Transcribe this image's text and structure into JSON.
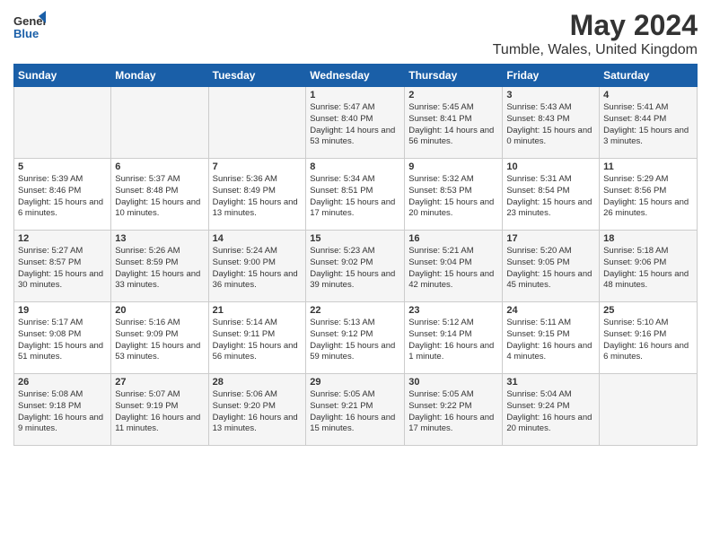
{
  "header": {
    "logo": {
      "general": "General",
      "blue": "Blue"
    },
    "title": "May 2024",
    "subtitle": "Tumble, Wales, United Kingdom"
  },
  "calendar": {
    "headers": [
      "Sunday",
      "Monday",
      "Tuesday",
      "Wednesday",
      "Thursday",
      "Friday",
      "Saturday"
    ],
    "weeks": [
      [
        {
          "day": "",
          "info": ""
        },
        {
          "day": "",
          "info": ""
        },
        {
          "day": "",
          "info": ""
        },
        {
          "day": "1",
          "info": "Sunrise: 5:47 AM\nSunset: 8:40 PM\nDaylight: 14 hours and 53 minutes."
        },
        {
          "day": "2",
          "info": "Sunrise: 5:45 AM\nSunset: 8:41 PM\nDaylight: 14 hours and 56 minutes."
        },
        {
          "day": "3",
          "info": "Sunrise: 5:43 AM\nSunset: 8:43 PM\nDaylight: 15 hours and 0 minutes."
        },
        {
          "day": "4",
          "info": "Sunrise: 5:41 AM\nSunset: 8:44 PM\nDaylight: 15 hours and 3 minutes."
        }
      ],
      [
        {
          "day": "5",
          "info": "Sunrise: 5:39 AM\nSunset: 8:46 PM\nDaylight: 15 hours and 6 minutes."
        },
        {
          "day": "6",
          "info": "Sunrise: 5:37 AM\nSunset: 8:48 PM\nDaylight: 15 hours and 10 minutes."
        },
        {
          "day": "7",
          "info": "Sunrise: 5:36 AM\nSunset: 8:49 PM\nDaylight: 15 hours and 13 minutes."
        },
        {
          "day": "8",
          "info": "Sunrise: 5:34 AM\nSunset: 8:51 PM\nDaylight: 15 hours and 17 minutes."
        },
        {
          "day": "9",
          "info": "Sunrise: 5:32 AM\nSunset: 8:53 PM\nDaylight: 15 hours and 20 minutes."
        },
        {
          "day": "10",
          "info": "Sunrise: 5:31 AM\nSunset: 8:54 PM\nDaylight: 15 hours and 23 minutes."
        },
        {
          "day": "11",
          "info": "Sunrise: 5:29 AM\nSunset: 8:56 PM\nDaylight: 15 hours and 26 minutes."
        }
      ],
      [
        {
          "day": "12",
          "info": "Sunrise: 5:27 AM\nSunset: 8:57 PM\nDaylight: 15 hours and 30 minutes."
        },
        {
          "day": "13",
          "info": "Sunrise: 5:26 AM\nSunset: 8:59 PM\nDaylight: 15 hours and 33 minutes."
        },
        {
          "day": "14",
          "info": "Sunrise: 5:24 AM\nSunset: 9:00 PM\nDaylight: 15 hours and 36 minutes."
        },
        {
          "day": "15",
          "info": "Sunrise: 5:23 AM\nSunset: 9:02 PM\nDaylight: 15 hours and 39 minutes."
        },
        {
          "day": "16",
          "info": "Sunrise: 5:21 AM\nSunset: 9:04 PM\nDaylight: 15 hours and 42 minutes."
        },
        {
          "day": "17",
          "info": "Sunrise: 5:20 AM\nSunset: 9:05 PM\nDaylight: 15 hours and 45 minutes."
        },
        {
          "day": "18",
          "info": "Sunrise: 5:18 AM\nSunset: 9:06 PM\nDaylight: 15 hours and 48 minutes."
        }
      ],
      [
        {
          "day": "19",
          "info": "Sunrise: 5:17 AM\nSunset: 9:08 PM\nDaylight: 15 hours and 51 minutes."
        },
        {
          "day": "20",
          "info": "Sunrise: 5:16 AM\nSunset: 9:09 PM\nDaylight: 15 hours and 53 minutes."
        },
        {
          "day": "21",
          "info": "Sunrise: 5:14 AM\nSunset: 9:11 PM\nDaylight: 15 hours and 56 minutes."
        },
        {
          "day": "22",
          "info": "Sunrise: 5:13 AM\nSunset: 9:12 PM\nDaylight: 15 hours and 59 minutes."
        },
        {
          "day": "23",
          "info": "Sunrise: 5:12 AM\nSunset: 9:14 PM\nDaylight: 16 hours and 1 minute."
        },
        {
          "day": "24",
          "info": "Sunrise: 5:11 AM\nSunset: 9:15 PM\nDaylight: 16 hours and 4 minutes."
        },
        {
          "day": "25",
          "info": "Sunrise: 5:10 AM\nSunset: 9:16 PM\nDaylight: 16 hours and 6 minutes."
        }
      ],
      [
        {
          "day": "26",
          "info": "Sunrise: 5:08 AM\nSunset: 9:18 PM\nDaylight: 16 hours and 9 minutes."
        },
        {
          "day": "27",
          "info": "Sunrise: 5:07 AM\nSunset: 9:19 PM\nDaylight: 16 hours and 11 minutes."
        },
        {
          "day": "28",
          "info": "Sunrise: 5:06 AM\nSunset: 9:20 PM\nDaylight: 16 hours and 13 minutes."
        },
        {
          "day": "29",
          "info": "Sunrise: 5:05 AM\nSunset: 9:21 PM\nDaylight: 16 hours and 15 minutes."
        },
        {
          "day": "30",
          "info": "Sunrise: 5:05 AM\nSunset: 9:22 PM\nDaylight: 16 hours and 17 minutes."
        },
        {
          "day": "31",
          "info": "Sunrise: 5:04 AM\nSunset: 9:24 PM\nDaylight: 16 hours and 20 minutes."
        },
        {
          "day": "",
          "info": ""
        }
      ]
    ]
  }
}
